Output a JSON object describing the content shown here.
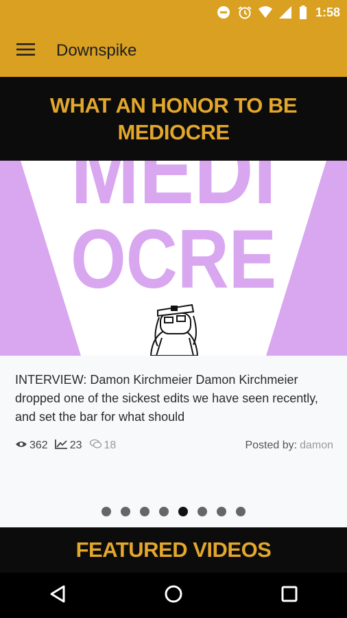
{
  "status_bar": {
    "time": "1:58",
    "icons": [
      "do-not-disturb-icon",
      "alarm-icon",
      "wifi-icon",
      "signal-icon",
      "battery-icon"
    ]
  },
  "app_bar": {
    "title": "Downspike",
    "menu_icon": "hamburger-menu-icon"
  },
  "hero": {
    "headline": "WHAT AN HONOR TO BE MEDIOCRE",
    "image_text_line1": "MEDI",
    "image_text_line2": "OCRE",
    "image_colors": {
      "purple": "#d9a6f0",
      "white": "#ffffff"
    }
  },
  "article": {
    "summary": "INTERVIEW: Damon Kirchmeier Damon Kirchmeier dropped one of the sickest edits we have seen recently, and set the bar for what should",
    "views": "362",
    "trend": "23",
    "comments": "18",
    "posted_by_label": "Posted by:",
    "author": "damon"
  },
  "carousel": {
    "page_count": 8,
    "active_index": 4
  },
  "featured": {
    "title": "FEATURED VIDEOS"
  },
  "nav_bar": {
    "icons": [
      "back-icon",
      "home-icon",
      "recents-icon"
    ]
  },
  "colors": {
    "accent": "#d9a021",
    "headline": "#e3a72c",
    "dark": "#0c0c0c"
  }
}
